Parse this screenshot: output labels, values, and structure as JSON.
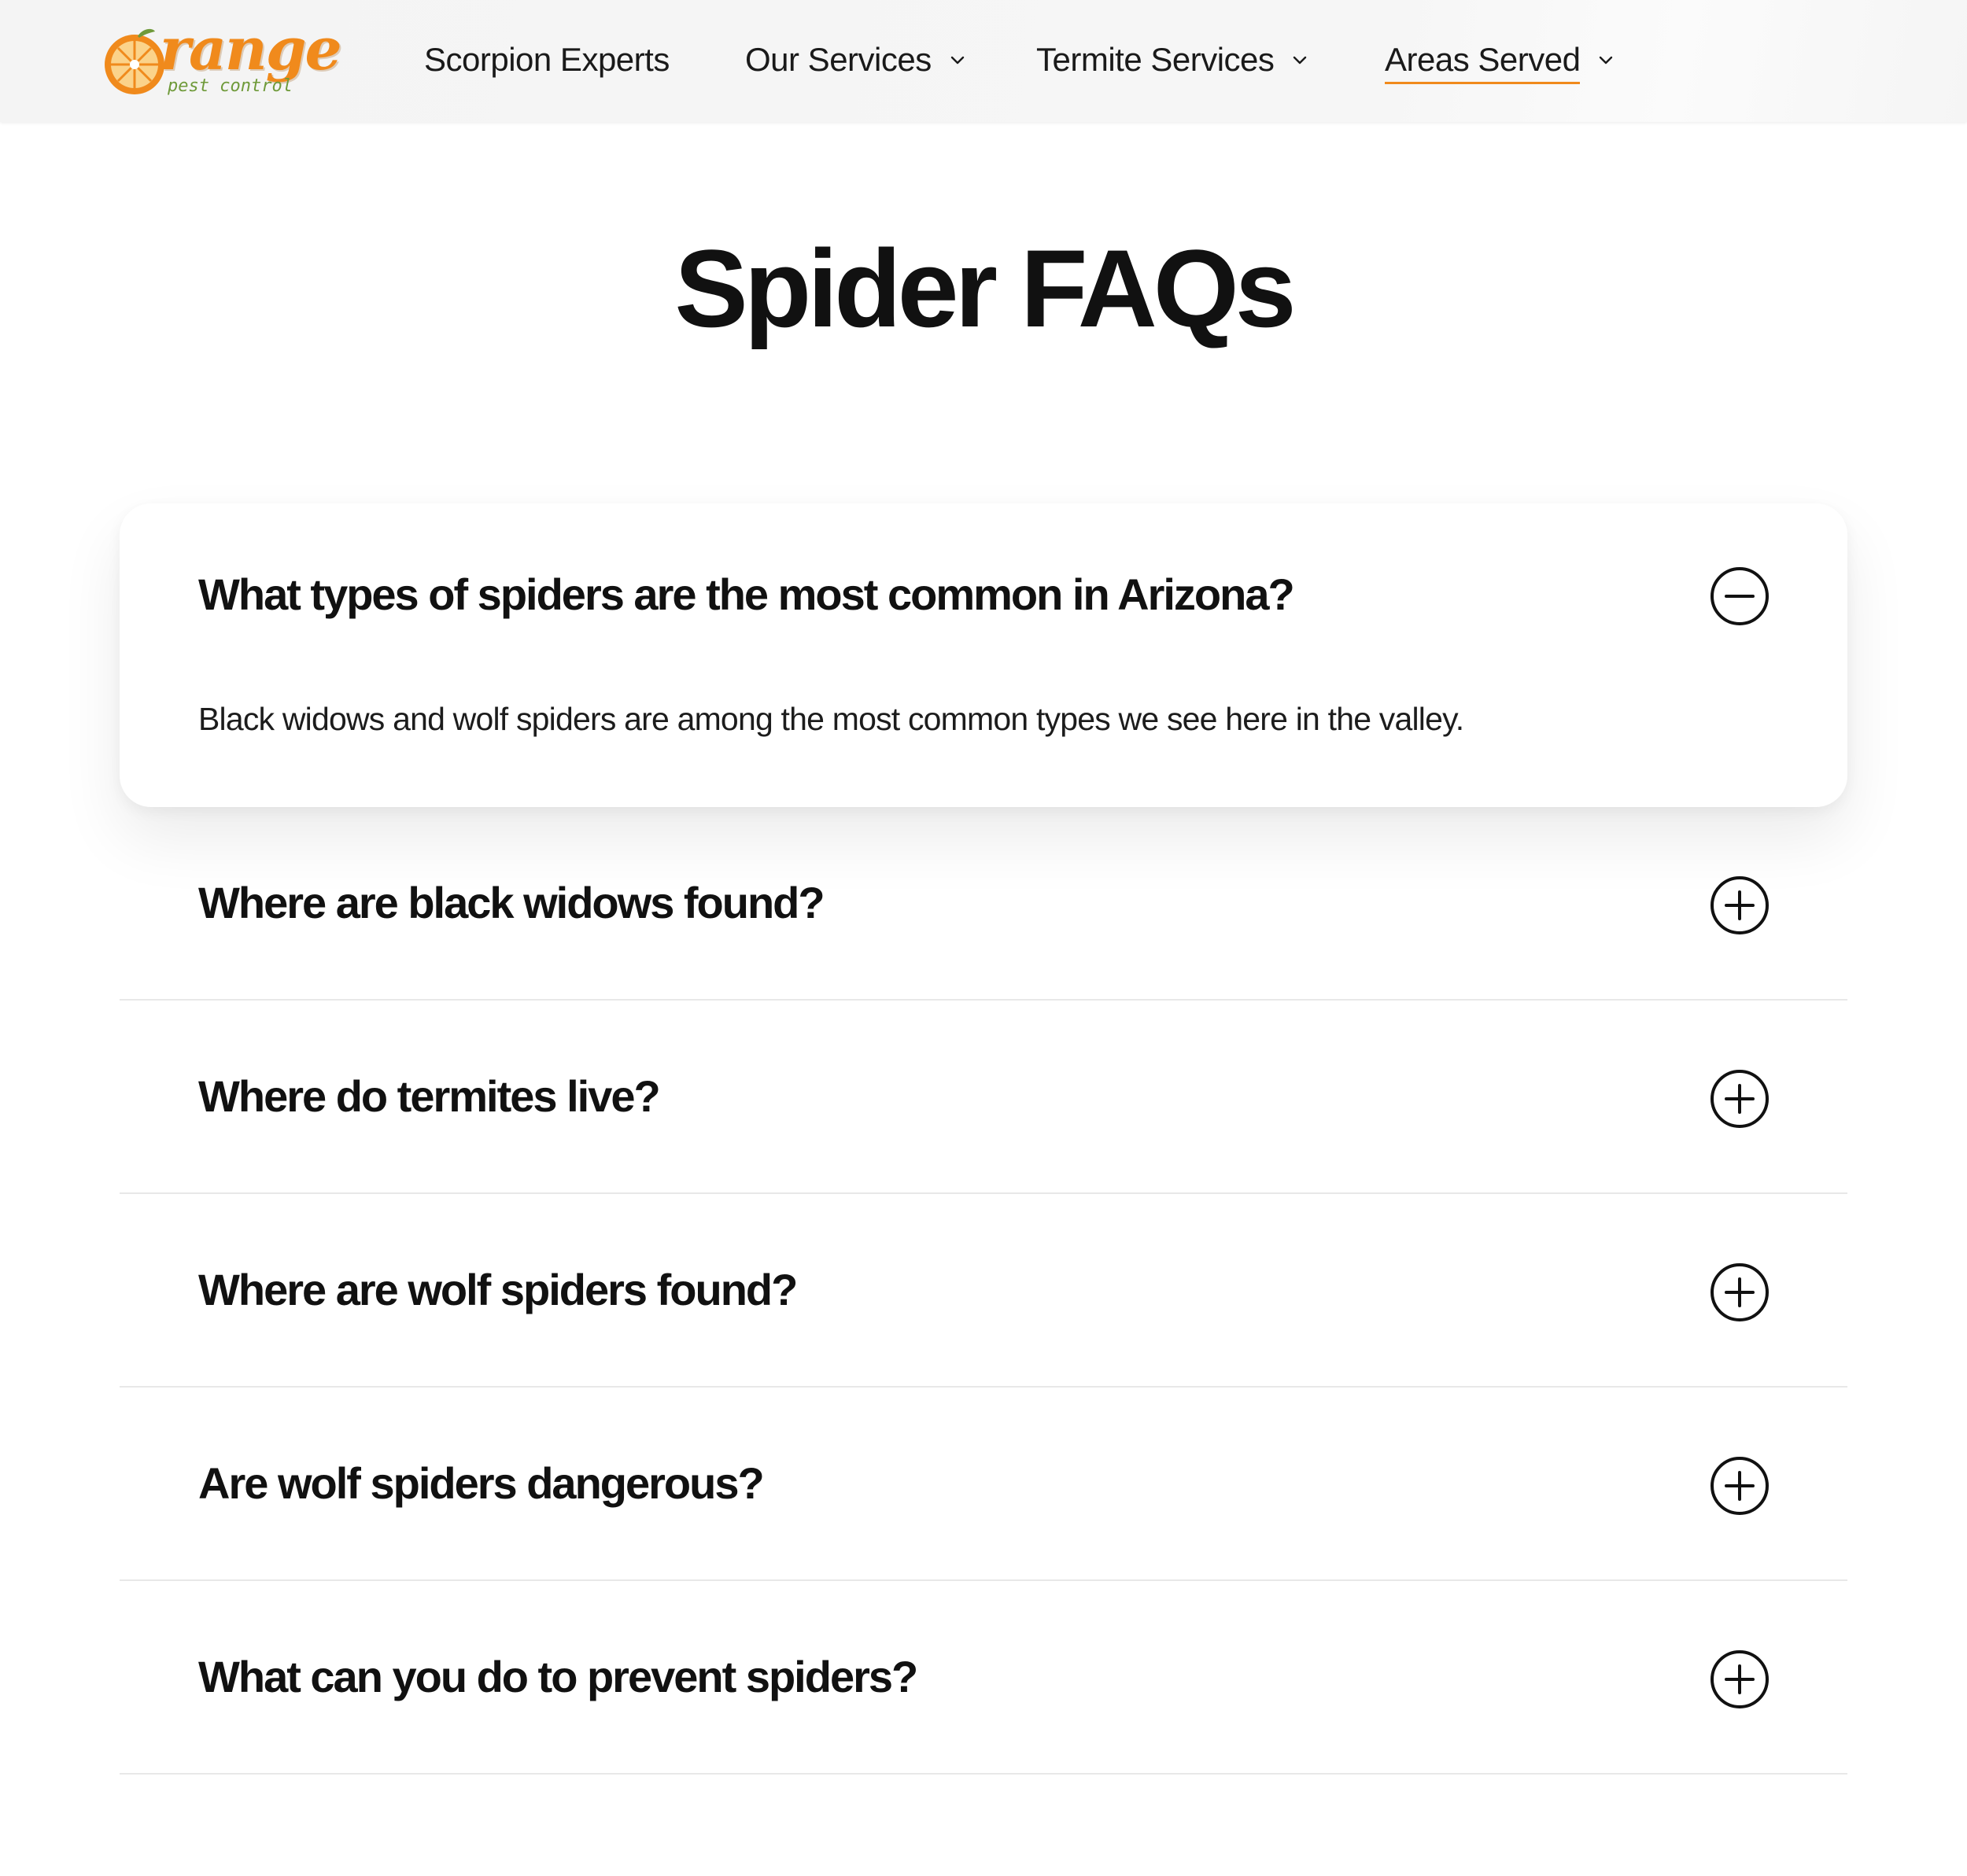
{
  "header": {
    "logo": {
      "word": "range",
      "sub": "pest control"
    },
    "nav": [
      {
        "label": "Scorpion Experts",
        "has_dropdown": false
      },
      {
        "label": "Our Services",
        "has_dropdown": true
      },
      {
        "label": "Termite Services",
        "has_dropdown": true
      },
      {
        "label": "Areas Served",
        "has_dropdown": true,
        "active": true
      }
    ]
  },
  "main": {
    "title": "Spider FAQs",
    "faqs": [
      {
        "question": "What types of spiders are the most common in Arizona?",
        "answer": "Black widows and wolf spiders are among the most common types we see here in the valley.",
        "expanded": true,
        "icon": "minus-circle-icon"
      },
      {
        "question": "Where are black widows found?",
        "expanded": false,
        "icon": "plus-circle-icon"
      },
      {
        "question": "Where do termites live?",
        "expanded": false,
        "icon": "plus-circle-icon"
      },
      {
        "question": "Where are wolf spiders found?",
        "expanded": false,
        "icon": "plus-circle-icon"
      },
      {
        "question": "Are wolf spiders dangerous?",
        "expanded": false,
        "icon": "plus-circle-icon"
      },
      {
        "question": "What can you do to prevent spiders?",
        "expanded": false,
        "icon": "plus-circle-icon"
      }
    ]
  },
  "colors": {
    "brand_orange": "#f08a1c",
    "brand_green": "#6f9a3a",
    "text": "#111111"
  }
}
